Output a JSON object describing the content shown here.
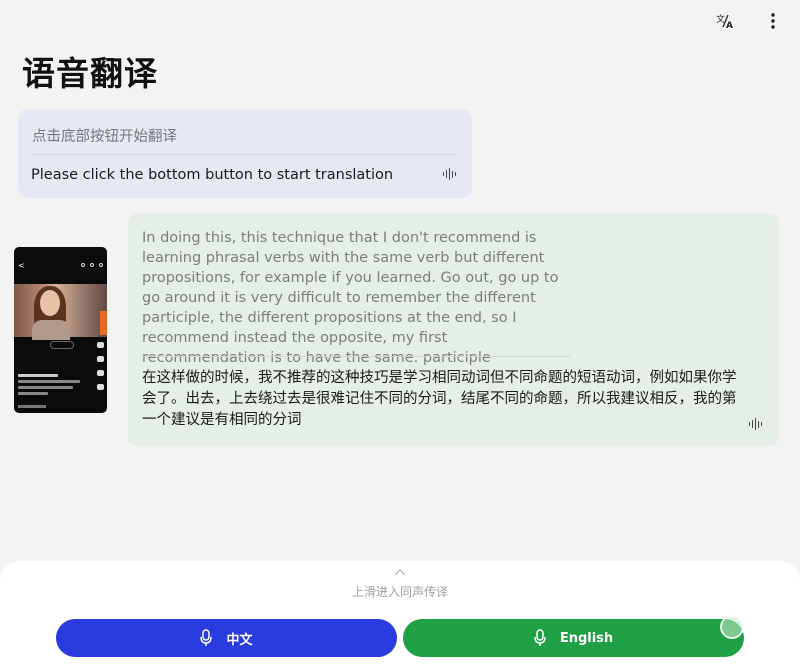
{
  "header": {
    "title": "语音翻译",
    "icons": [
      "translate-icon",
      "more-vertical-icon"
    ]
  },
  "hint": {
    "source": "点击底部按钮开始翻译",
    "target": "Please click the bottom button to start translation",
    "icon": "waveform-icon"
  },
  "thumbnail": {
    "icon": "video-thumbnail"
  },
  "translation": {
    "source": "In doing this, this technique that I don't recommend is learning phrasal verbs with the same verb but different propositions, for example if you learned. Go out, go up to go around it is very difficult to remember the different participle, the different propositions at the end, so I recommend instead the opposite, my first recommendation is to have the same. participle",
    "target": "在这样做的时候，我不推荐的这种技巧是学习相同动词但不同命题的短语动词，例如如果你学会了。出去，上去绕过去是很难记住不同的分词，结尾不同的命题，所以我建议相反，我的第一个建议是有相同的分词",
    "icon": "waveform-icon"
  },
  "bottom": {
    "swipe_hint": "上滑进入同声传译",
    "chinese_button": "中文",
    "english_button": "English",
    "chinese_color": "#2a3be0",
    "english_color": "#1fa044"
  }
}
